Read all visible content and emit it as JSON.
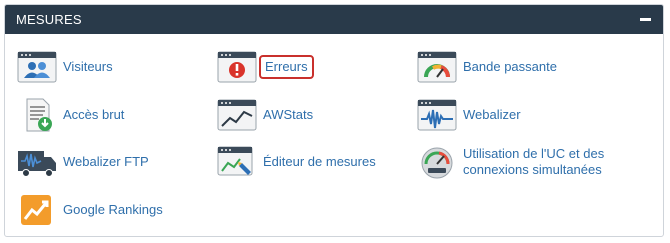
{
  "panel": {
    "title": "MESURES"
  },
  "items": [
    {
      "label": "Visiteurs",
      "icon": "visitors-icon"
    },
    {
      "label": "Erreurs",
      "icon": "error-icon"
    },
    {
      "label": "Bande passante",
      "icon": "bandwidth-icon"
    },
    {
      "label": "Accès brut",
      "icon": "raw-access-icon"
    },
    {
      "label": "AWStats",
      "icon": "awstats-icon"
    },
    {
      "label": "Webalizer",
      "icon": "webalizer-icon"
    },
    {
      "label": "Webalizer FTP",
      "icon": "webalizer-ftp-icon"
    },
    {
      "label": "Éditeur de mesures",
      "icon": "metrics-editor-icon"
    },
    {
      "label": "Utilisation de l'UC et des connexions simultanées",
      "icon": "cpu-usage-icon"
    },
    {
      "label": "Google Rankings",
      "icon": "google-rankings-icon"
    }
  ],
  "colors": {
    "header": "#293a4a",
    "link": "#2f6fab",
    "highlight": "#c9302c"
  }
}
